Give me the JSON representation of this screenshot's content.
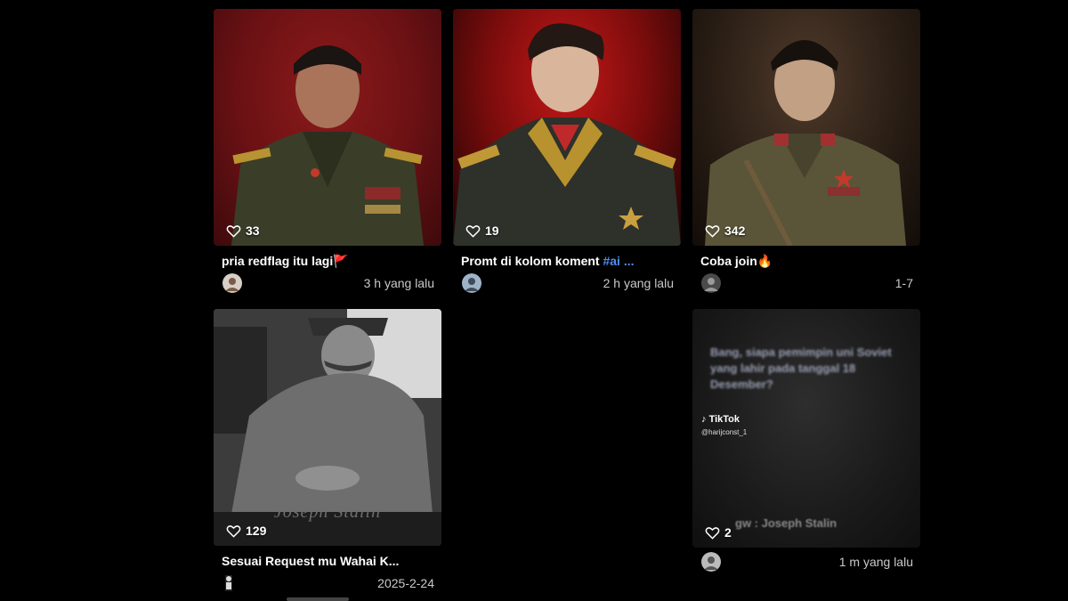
{
  "posts": [
    {
      "likes": "33",
      "caption": "pria redflag itu lagi🚩",
      "time": "3 h yang lalu"
    },
    {
      "likes": "19",
      "caption_text": "Promt di kolom koment ",
      "caption_tag": "#ai ...",
      "time": "2 h yang lalu"
    },
    {
      "likes": "342",
      "caption": "Coba join🔥",
      "time": "1-7"
    },
    {
      "likes": "129",
      "caption": "Sesuai Request mu Wahai K...",
      "time": "2025-2-24",
      "overlay_name": "Joseph Stalin"
    },
    {
      "likes": "2",
      "time": "1 m yang lalu",
      "overlay_text": "Bang, siapa pemimpin uni Soviet yang lahir pada tanggal 18 Desember?",
      "tiktok_label": "TikTok",
      "tiktok_user": "@harijconst_1",
      "overlay_answer": "gw : Joseph Stalin"
    }
  ],
  "colors": {
    "background": "#000000",
    "hashtag": "#4e8df5"
  }
}
